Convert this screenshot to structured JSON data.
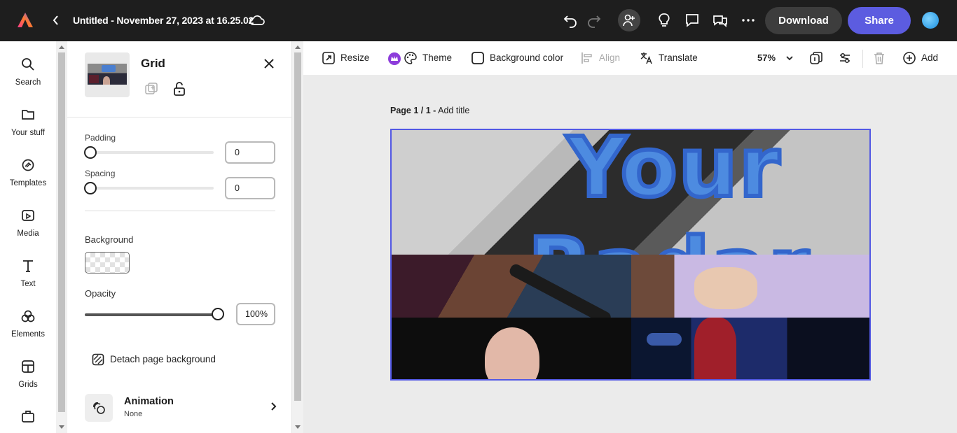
{
  "topbar": {
    "doc_title": "Untitled - November 27, 2023 at 16.25.02",
    "download_label": "Download",
    "share_label": "Share"
  },
  "rail": {
    "items": [
      {
        "label": "Search",
        "icon": "search-icon"
      },
      {
        "label": "Your stuff",
        "icon": "folder-icon"
      },
      {
        "label": "Templates",
        "icon": "templates-icon"
      },
      {
        "label": "Media",
        "icon": "media-icon"
      },
      {
        "label": "Text",
        "icon": "text-icon"
      },
      {
        "label": "Elements",
        "icon": "elements-icon"
      },
      {
        "label": "Grids",
        "icon": "grids-icon"
      },
      {
        "label": "",
        "icon": "add-ons-icon"
      }
    ]
  },
  "panel": {
    "title": "Grid",
    "padding_label": "Padding",
    "padding_value": "0",
    "spacing_label": "Spacing",
    "spacing_value": "0",
    "background_label": "Background",
    "opacity_label": "Opacity",
    "opacity_value": "100%",
    "opacity_level": 1.0,
    "detach_label": "Detach page background",
    "animation_title": "Animation",
    "animation_value": "None"
  },
  "toolbar2": {
    "resize_label": "Resize",
    "theme_label": "Theme",
    "background_color_label": "Background color",
    "align_label": "Align",
    "translate_label": "Translate",
    "zoom": "57%",
    "add_label": "Add"
  },
  "canvas": {
    "page_label": "Page 1 / 1 -",
    "add_title": "Add title",
    "headline_line1": "Your",
    "headline_line2": "Radar",
    "accent_color": "#5258e4",
    "text_color": "#4d8be0"
  },
  "colors": {
    "share": "#5c5ce0",
    "topbar": "#1e1e1e"
  }
}
